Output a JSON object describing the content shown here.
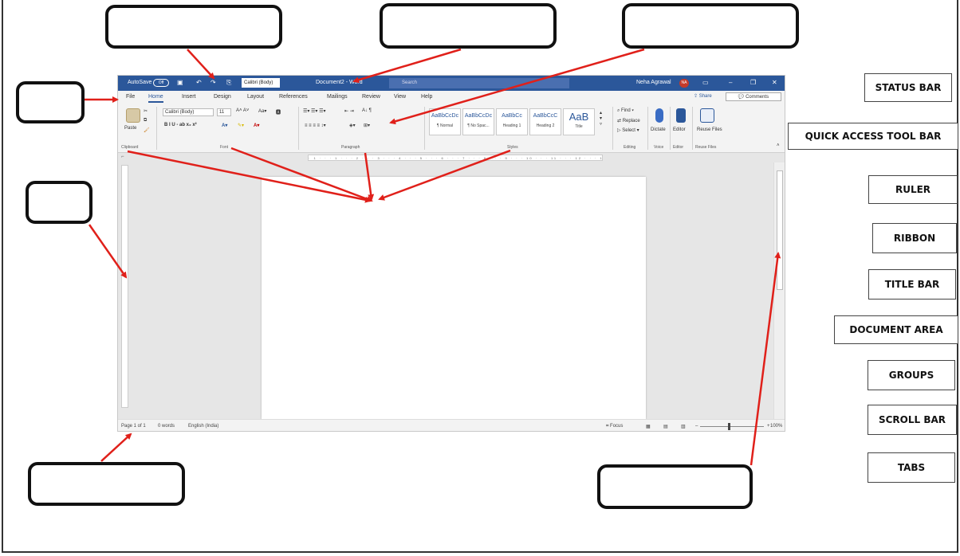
{
  "labels": [
    "STATUS BAR",
    "QUICK ACCESS TOOL BAR",
    "RULER",
    "RIBBON",
    "TITLE BAR",
    "DOCUMENT AREA",
    "GROUPS",
    "SCROLL BAR",
    "TABS"
  ],
  "word": {
    "titlebar": {
      "autosave": "AutoSave",
      "autosave_state": "Off",
      "font_box": "Calibri (Body)",
      "doc_title": "Document2 - Word",
      "search_placeholder": "Search",
      "user": "Neha Agrawal",
      "user_initials": "NA"
    },
    "tabs": [
      "File",
      "Home",
      "Insert",
      "Design",
      "Layout",
      "References",
      "Mailings",
      "Review",
      "View",
      "Help"
    ],
    "share": "Share",
    "comments": "Comments",
    "ribbon": {
      "paste": "Paste",
      "font_name": "Calibri (Body)",
      "font_size": "11",
      "format_row": "B  I  U  -  ab  x₂  x²",
      "styles": [
        {
          "preview": "AaBbCcDc",
          "name": "¶ Normal"
        },
        {
          "preview": "AaBbCcDc",
          "name": "¶ No Spac..."
        },
        {
          "preview": "AaBbCc",
          "name": "Heading 1"
        },
        {
          "preview": "AaBbCcC",
          "name": "Heading 2"
        },
        {
          "preview": "AaB",
          "name": "Title"
        }
      ],
      "find": "Find",
      "replace": "Replace",
      "select": "Select",
      "dictate": "Dictate",
      "editor": "Editor",
      "reuse_files": "Reuse Files",
      "groups": [
        "Clipboard",
        "Font",
        "Paragraph",
        "Styles",
        "Editing",
        "Voice",
        "Editor",
        "Reuse Files"
      ]
    },
    "ruler_marks": "· 1 · · · 1 · · · 2 · · · 3 · · · 4 · · · 5 · · · 6 · · · 7 · · · 8 · · · 9 · · · 10 · · · 11 · · · 12 · · · 13 · · · 14 · · · 15 ·",
    "statusbar": {
      "page": "Page 1 of 1",
      "words": "0 words",
      "language": "English (India)",
      "focus": "Focus",
      "zoom": "100%"
    }
  }
}
